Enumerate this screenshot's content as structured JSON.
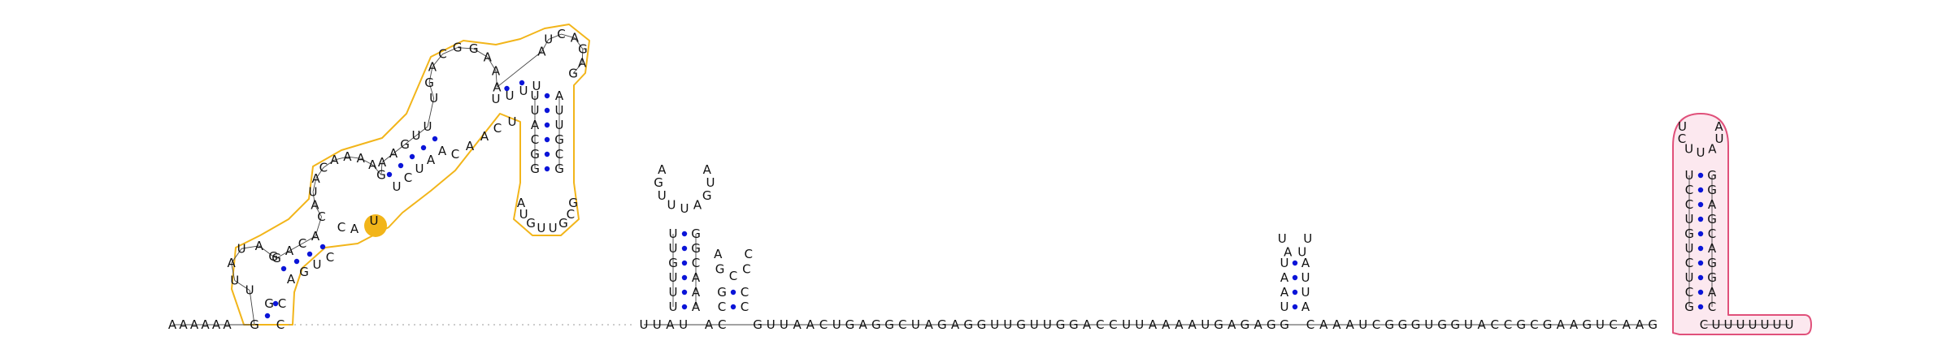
{
  "colors": {
    "nucleotide_text": "#111111",
    "base_pair_dot": "#0a14d8",
    "highlight_orange": "#f2b51a",
    "highlight_pink": "#e0507a",
    "highlight_pink_fill": "#fce8ef",
    "backbone": "#444444",
    "linker": "#999999"
  },
  "sequence_5prime": "AAAAAAGC",
  "sequence_main": "UUAUUGUUGAUUGUAGUGCAAAUUAGCGCCGUUAACUGAGGCUAGAGGUUGUUGGACCUUAAAAUGAGAGGUUUAAUUAAUCAAAUCGGGUGGUACCGCGAAGUCAAGCUCUGUCCUUUAAGGAGCAGGCUUUUUUU",
  "structure": {
    "stem_loop_left": {
      "hairpin1": [
        "U",
        "U",
        "A",
        "U",
        "A",
        "G"
      ],
      "hairpin2": [
        "C",
        "A",
        "U",
        "A",
        "C",
        "A",
        "A",
        "A",
        "A",
        "G"
      ],
      "hairpin3": [
        "U",
        "G",
        "A",
        "C",
        "G",
        "G",
        "A",
        "A",
        "A"
      ],
      "hairpin4": [
        "A",
        "U",
        "C",
        "A",
        "G",
        "A",
        "G"
      ],
      "terminal_hairpin": [
        "A",
        "U",
        "G",
        "U",
        "U",
        "G",
        "C",
        "G",
        "G",
        "U",
        "G",
        "G",
        "U",
        "C",
        "G",
        "A"
      ]
    },
    "hairpin_mid1_loop": [
      "A",
      "G",
      "U",
      "U",
      "U",
      "A",
      "G",
      "U",
      "A"
    ],
    "hairpin_mid2_loop": [
      "A",
      "G",
      "C",
      "C",
      "C"
    ],
    "hairpin_mid3_loop": [
      "U",
      "A",
      "U",
      "U"
    ],
    "terminator_loop": [
      "U",
      "C",
      "U",
      "U",
      "A",
      "U",
      "A"
    ]
  }
}
